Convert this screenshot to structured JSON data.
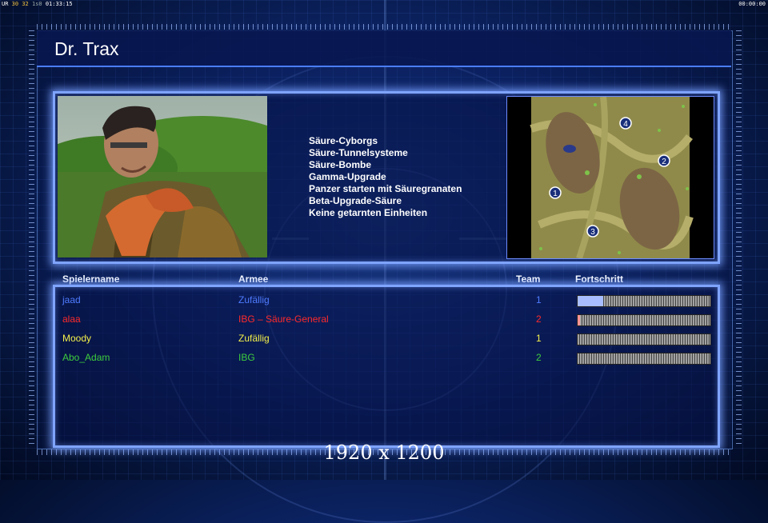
{
  "topbar": {
    "left_prefix": "UR",
    "left_a": "30",
    "left_b": "32",
    "left_c": "1s0",
    "left_time": "01:33:15",
    "right_time": "00:00:00"
  },
  "general_name": "Dr. Trax",
  "features": [
    "Säure-Cyborgs",
    "Säure-Tunnelsysteme",
    "Säure-Bombe",
    "Gamma-Upgrade",
    "Panzer starten mit Säuregranaten",
    "Beta-Upgrade-Säure",
    "Keine getarnten Einheiten"
  ],
  "map": {
    "start_positions": [
      "1",
      "2",
      "3",
      "4"
    ]
  },
  "players_header": {
    "name": "Spielername",
    "army": "Armee",
    "team": "Team",
    "progress": "Fortschritt"
  },
  "players": [
    {
      "name": "jaad",
      "army": "Zufällig",
      "team": "1",
      "color": "#4f7bff",
      "progress": 0.19
    },
    {
      "name": "alaa",
      "army": "IBG – Säure-General",
      "team": "2",
      "color": "#ff2a2a",
      "progress": 0.02
    },
    {
      "name": "Moody",
      "army": "Zufällig",
      "team": "1",
      "color": "#f4f04a",
      "progress": 0.0
    },
    {
      "name": "Abo_Adam",
      "army": "IBG",
      "team": "2",
      "color": "#3dcc3d",
      "progress": 0.0
    }
  ],
  "resolution_label": "1920 x 1200"
}
